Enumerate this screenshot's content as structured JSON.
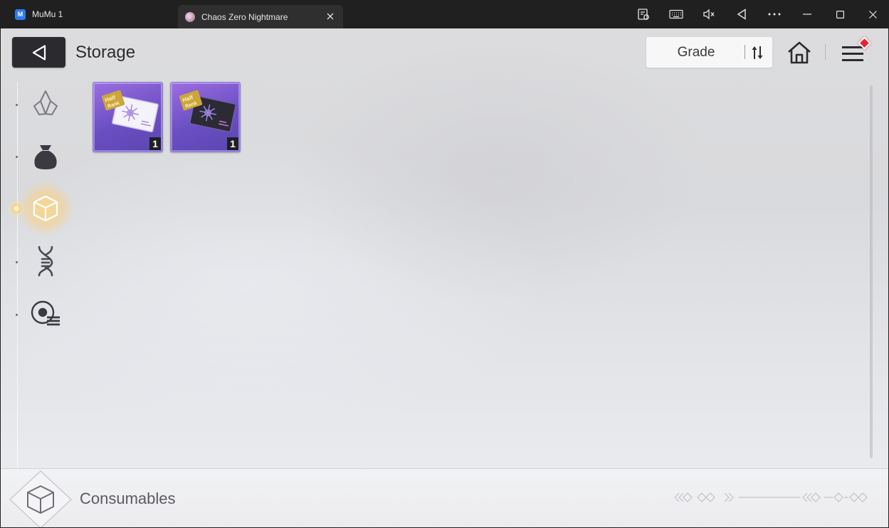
{
  "window": {
    "tabs": [
      {
        "label": "MuMu 1",
        "logo_text": "M"
      },
      {
        "label": "Chaos Zero Nightmare"
      }
    ],
    "controls": [
      "app-center-icon",
      "keyboard-icon",
      "mute-icon",
      "back-nav-icon",
      "more-icon",
      "minimize-icon",
      "maximize-icon",
      "close-icon"
    ]
  },
  "header": {
    "title": "Storage",
    "sort_label": "Grade"
  },
  "sidebar": {
    "categories": [
      {
        "id": "crystals",
        "icon": "crystal-icon",
        "active": false
      },
      {
        "id": "bag",
        "icon": "pouch-icon",
        "active": false
      },
      {
        "id": "consumables",
        "icon": "cube-icon",
        "active": true
      },
      {
        "id": "dna",
        "icon": "dna-icon",
        "active": false
      },
      {
        "id": "records",
        "icon": "record-list-icon",
        "active": false
      }
    ]
  },
  "items": [
    {
      "name": "ticket-white",
      "count": "1",
      "grade_color": "#7a5ad0"
    },
    {
      "name": "ticket-black",
      "count": "1",
      "grade_color": "#7a5ad0"
    }
  ],
  "footer": {
    "category_label": "Consumables"
  },
  "colors": {
    "active_glow": "#ffd27a",
    "badge": "#e02535",
    "item_grade": "#7a5ad0"
  }
}
